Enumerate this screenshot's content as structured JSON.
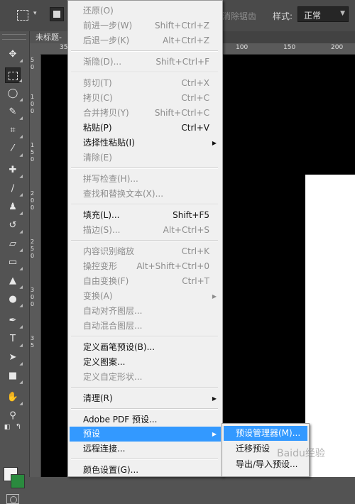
{
  "options_bar": {
    "antialias_label": "消除锯齿",
    "style_label": "样式:",
    "style_value": "正常"
  },
  "document_tab": {
    "title": "未标题-"
  },
  "ruler": {
    "top_ticks": [
      "35",
      "100",
      "150",
      "200"
    ],
    "left_ticks": [
      "5",
      "0",
      "1",
      "0",
      "0",
      "1",
      "5",
      "0",
      "2",
      "0",
      "0",
      "2",
      "5",
      "0",
      "3",
      "0",
      "0",
      "3",
      "5"
    ]
  },
  "edit_menu": {
    "items": [
      {
        "label": "还原(O)",
        "shortcut": "",
        "disabled": true
      },
      {
        "label": "前进一步(W)",
        "shortcut": "Shift+Ctrl+Z",
        "disabled": true
      },
      {
        "label": "后退一步(K)",
        "shortcut": "Alt+Ctrl+Z",
        "disabled": true
      },
      {
        "label": "渐隐(D)...",
        "shortcut": "Shift+Ctrl+F",
        "disabled": true
      },
      {
        "label": "剪切(T)",
        "shortcut": "Ctrl+X",
        "disabled": true
      },
      {
        "label": "拷贝(C)",
        "shortcut": "Ctrl+C",
        "disabled": true
      },
      {
        "label": "合并拷贝(Y)",
        "shortcut": "Shift+Ctrl+C",
        "disabled": true
      },
      {
        "label": "粘贴(P)",
        "shortcut": "Ctrl+V",
        "disabled": false
      },
      {
        "label": "选择性粘贴(I)",
        "shortcut": "",
        "disabled": false
      },
      {
        "label": "清除(E)",
        "shortcut": "",
        "disabled": true
      },
      {
        "label": "拼写检查(H)...",
        "shortcut": "",
        "disabled": true
      },
      {
        "label": "查找和替换文本(X)...",
        "shortcut": "",
        "disabled": true
      },
      {
        "label": "填充(L)...",
        "shortcut": "Shift+F5",
        "disabled": false
      },
      {
        "label": "描边(S)...",
        "shortcut": "Alt+Ctrl+S",
        "disabled": true
      },
      {
        "label": "内容识别缩放",
        "shortcut": "Ctrl+K",
        "disabled": true
      },
      {
        "label": "操控变形",
        "shortcut": "Alt+Shift+Ctrl+0",
        "disabled": true
      },
      {
        "label": "自由变换(F)",
        "shortcut": "Ctrl+T",
        "disabled": true
      },
      {
        "label": "变换(A)",
        "shortcut": "",
        "disabled": true
      },
      {
        "label": "自动对齐图层...",
        "shortcut": "",
        "disabled": true
      },
      {
        "label": "自动混合图层...",
        "shortcut": "",
        "disabled": true
      },
      {
        "label": "定义画笔预设(B)...",
        "shortcut": "",
        "disabled": false
      },
      {
        "label": "定义图案...",
        "shortcut": "",
        "disabled": false
      },
      {
        "label": "定义自定形状...",
        "shortcut": "",
        "disabled": true
      },
      {
        "label": "清理(R)",
        "shortcut": "",
        "disabled": false
      },
      {
        "label": "Adobe PDF 预设...",
        "shortcut": "",
        "disabled": false
      },
      {
        "label": "预设",
        "shortcut": "",
        "disabled": false
      },
      {
        "label": "远程连接...",
        "shortcut": "",
        "disabled": false
      },
      {
        "label": "颜色设置(G)...",
        "shortcut": "",
        "disabled": false
      }
    ]
  },
  "presets_submenu": {
    "items": [
      {
        "label": "预设管理器(M)..."
      },
      {
        "label": "迁移预设"
      },
      {
        "label": "导出/导入预设..."
      }
    ]
  },
  "watermark": {
    "text": "Baidu经验"
  },
  "colors": {
    "menu_bg": "#f0f0f0",
    "highlight": "#3399ff",
    "disabled_text": "#8c8c8c",
    "canvas": "#000000",
    "panel": "#535353",
    "background_swatch": "#2a8a3e"
  }
}
